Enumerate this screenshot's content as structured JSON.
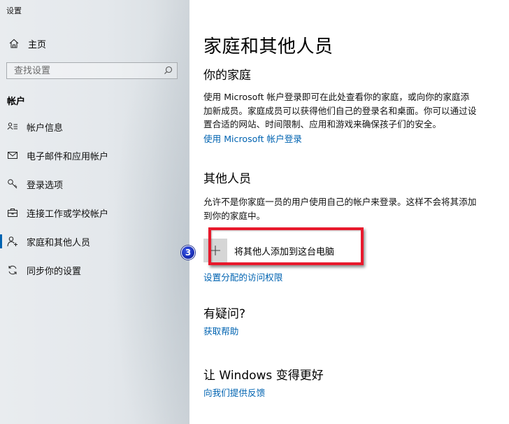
{
  "window": {
    "title": "设置"
  },
  "sidebar": {
    "home_label": "主页",
    "search_placeholder": "查找设置",
    "section_label": "帐户",
    "items": [
      {
        "label": "帐户信息",
        "icon": "account-info-icon"
      },
      {
        "label": "电子邮件和应用帐户",
        "icon": "mail-icon"
      },
      {
        "label": "登录选项",
        "icon": "key-icon"
      },
      {
        "label": "连接工作或学校帐户",
        "icon": "briefcase-icon"
      },
      {
        "label": "家庭和其他人员",
        "icon": "people-icon",
        "active": true
      },
      {
        "label": "同步你的设置",
        "icon": "sync-icon"
      }
    ]
  },
  "main": {
    "title": "家庭和其他人员",
    "family": {
      "heading": "你的家庭",
      "description": "使用 Microsoft 帐户登录即可在此处查看你的家庭，或向你的家庭添加新成员。家庭成员可以获得他们自己的登录名和桌面。你可以通过设置合适的网站、时间限制、应用和游戏来确保孩子们的安全。",
      "link": "使用 Microsoft 帐户登录"
    },
    "others": {
      "heading": "其他人员",
      "description": "允许不是你家庭一员的用户使用自己的帐户来登录。这样不会将其添加到你的家庭中。",
      "add_button_label": "将其他人添加到这台电脑",
      "assigned_access_link": "设置分配的访问权限"
    },
    "questions": {
      "heading": "有疑问?",
      "link": "获取帮助"
    },
    "feedback": {
      "heading": "让 Windows 变得更好",
      "link": "向我们提供反馈"
    }
  },
  "annotation": {
    "step_number": "3"
  },
  "colors": {
    "accent": "#0063b1",
    "highlight": "#e8192c",
    "badge": "#1a2fb8"
  }
}
